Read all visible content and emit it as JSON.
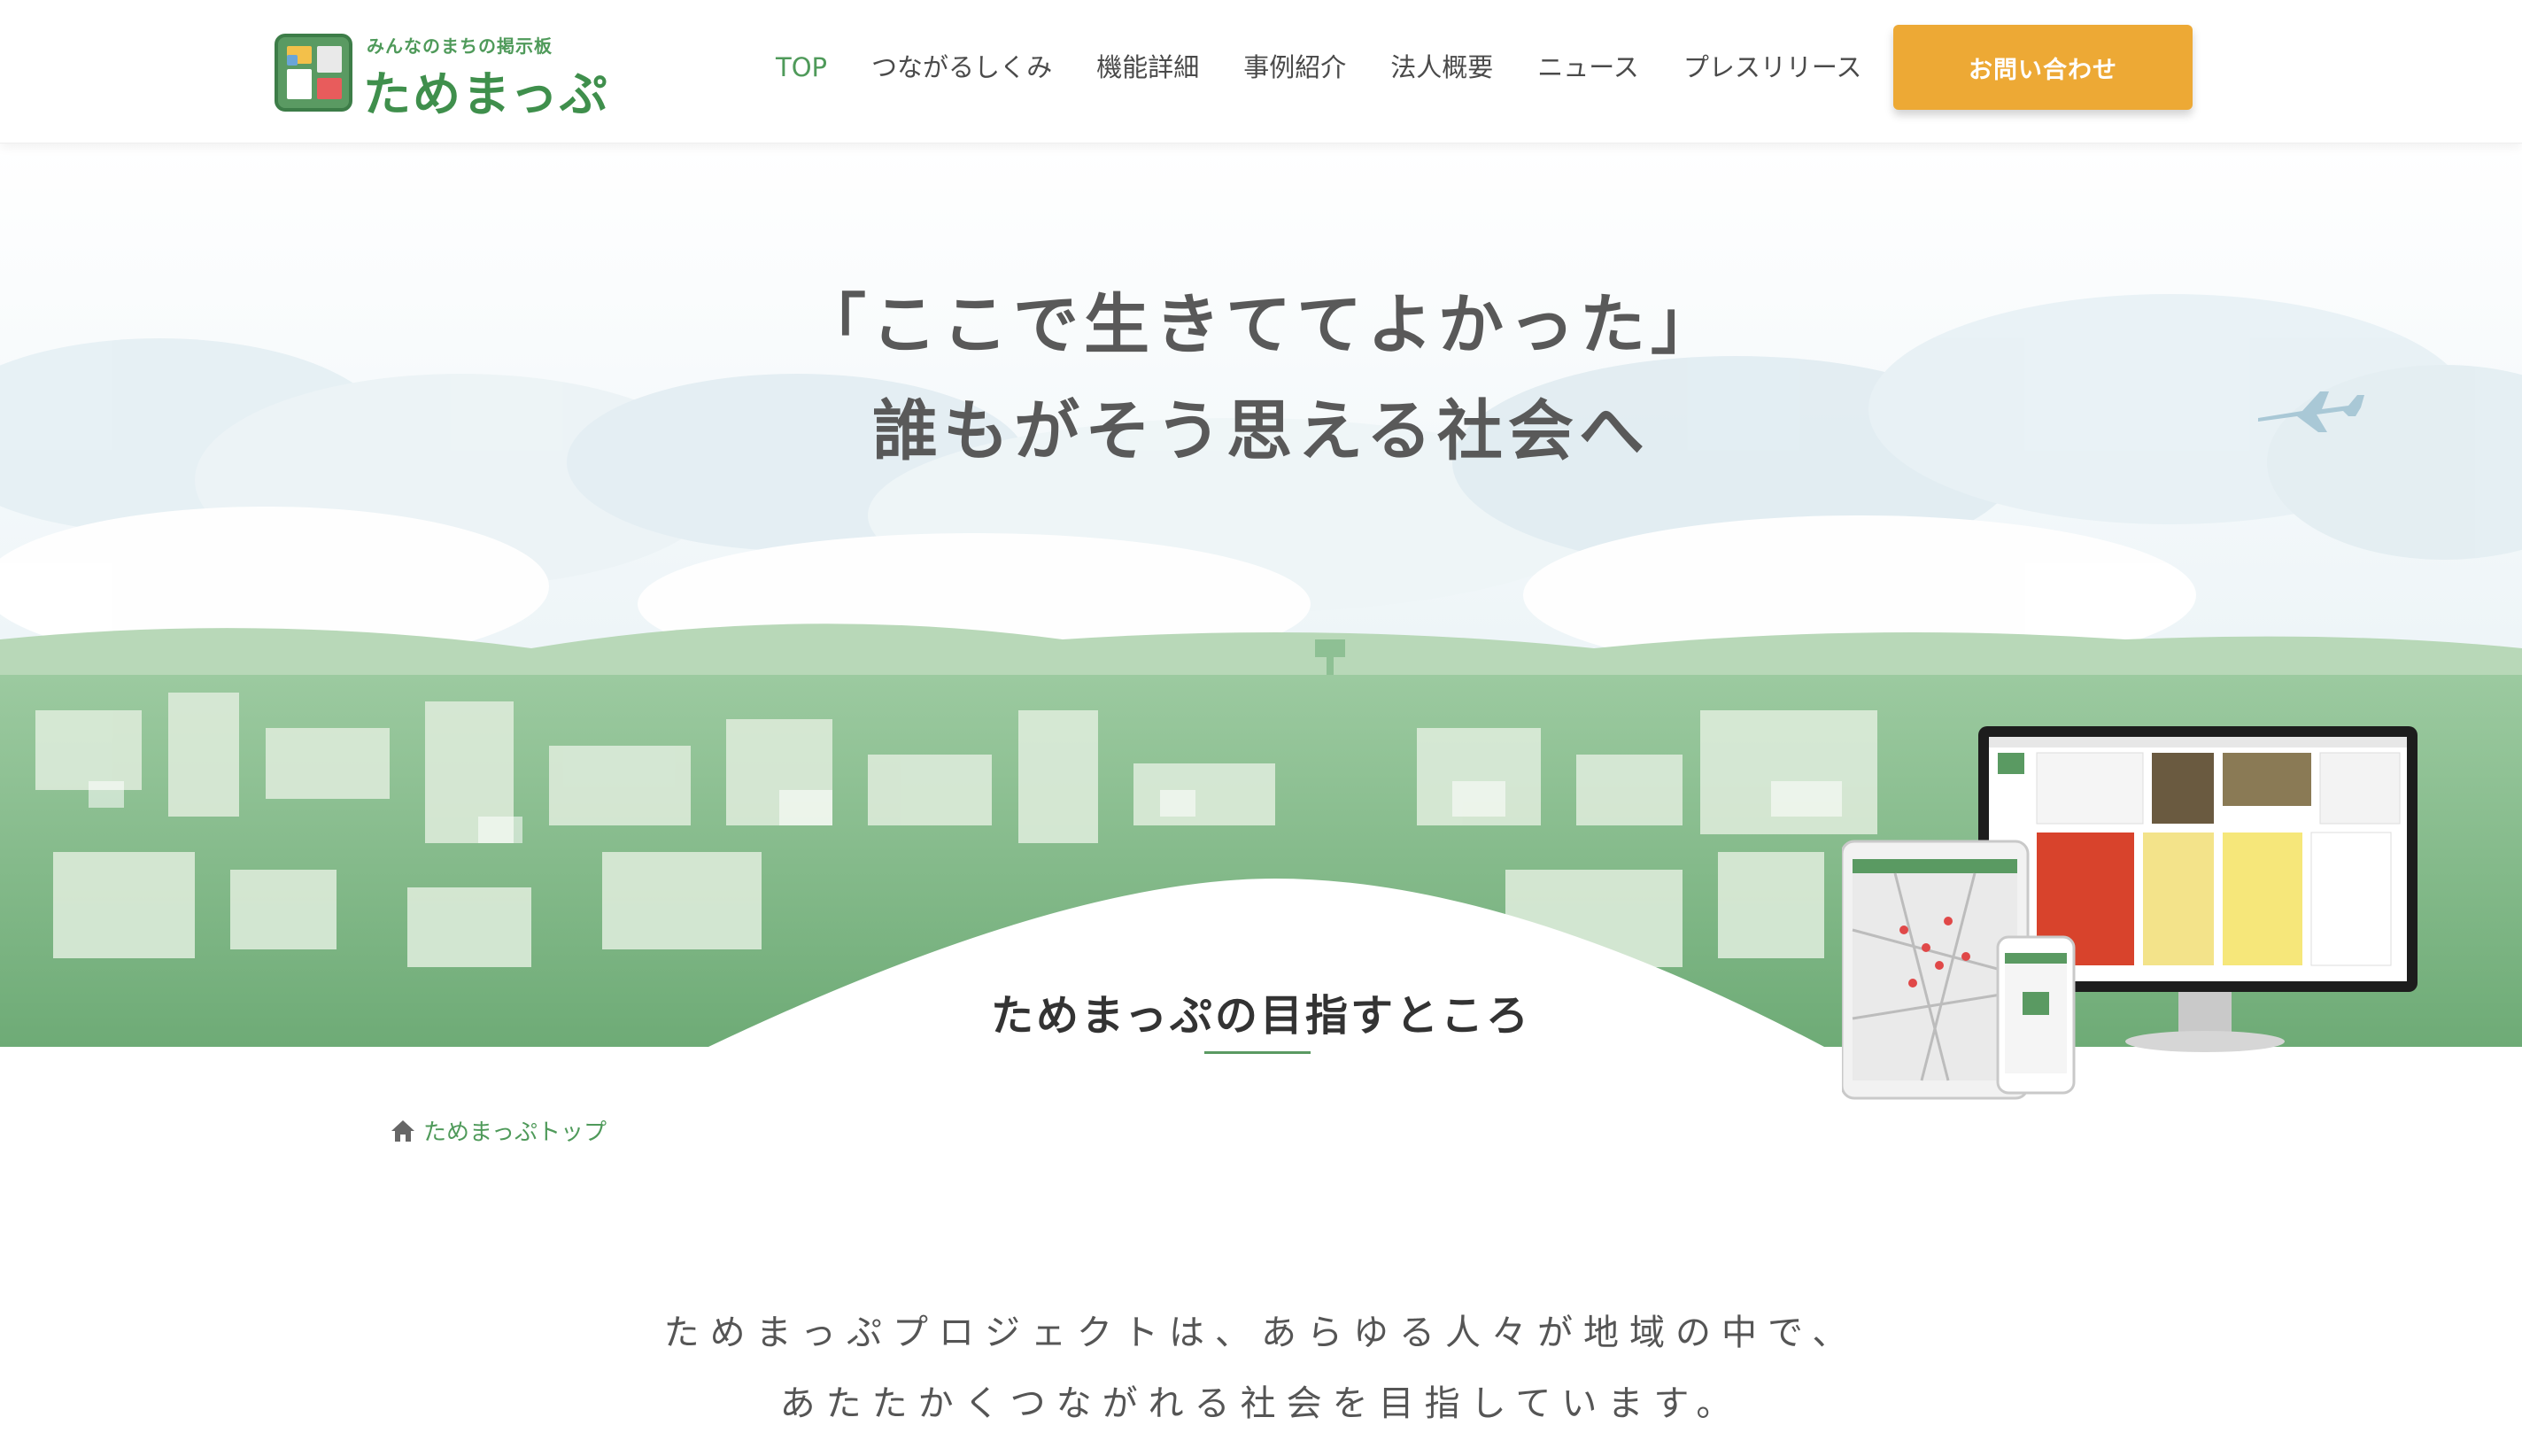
{
  "header": {
    "logo": {
      "tagline": "みんなのまちの掲示板",
      "name": "ためまっぷ"
    },
    "nav": [
      {
        "label": "TOP",
        "active": true
      },
      {
        "label": "つながるしくみ",
        "active": false
      },
      {
        "label": "機能詳細",
        "active": false
      },
      {
        "label": "事例紹介",
        "active": false
      },
      {
        "label": "法人概要",
        "active": false
      },
      {
        "label": "ニュース",
        "active": false
      },
      {
        "label": "プレスリリース",
        "active": false
      }
    ],
    "contact_button": "お問い合わせ"
  },
  "hero": {
    "headline_line1": "「ここで生きててよかった」",
    "headline_line2": "誰もがそう思える社会へ",
    "subheading": "ためまっぷの目指すところ"
  },
  "breadcrumb": {
    "icon": "home-icon",
    "label": "ためまっぷトップ"
  },
  "intro": {
    "line1": "ためまっぷプロジェクトは、あらゆる人々が地域の中で、",
    "line2": "あたたかくつながれる社会を目指しています。"
  },
  "colors": {
    "brand_green": "#4f9a5a",
    "accent_orange": "#eda935",
    "text_gray": "#555555",
    "city_green": "#7fb985"
  }
}
